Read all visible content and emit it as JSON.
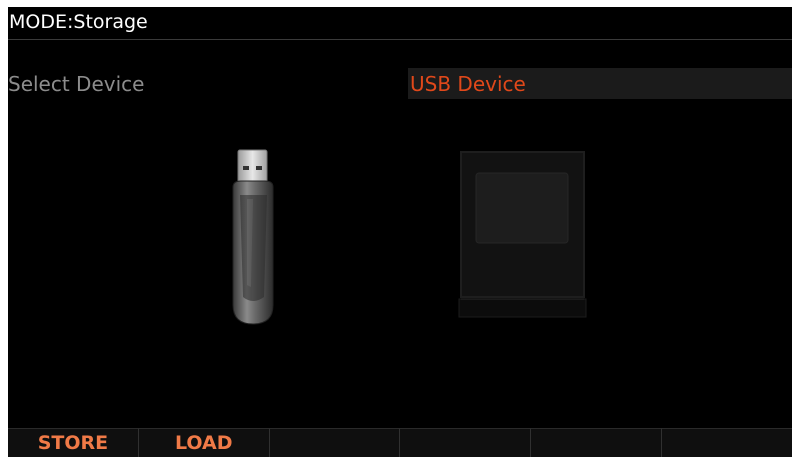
{
  "title_bar": {
    "mode_text": "MODE:Storage"
  },
  "parameter": {
    "label": "Select Device",
    "value": "USB Device"
  },
  "devices": [
    {
      "icon": "usb-drive-icon"
    },
    {
      "icon": "storage-device-icon"
    }
  ],
  "softkeys": [
    "STORE",
    "LOAD",
    "",
    "",
    "",
    ""
  ],
  "colors": {
    "background": "#000000",
    "title_text": "#ffffff",
    "label_text": "#8c8c8c",
    "value_text": "#e0481a",
    "softkey_text": "#f07a47"
  }
}
